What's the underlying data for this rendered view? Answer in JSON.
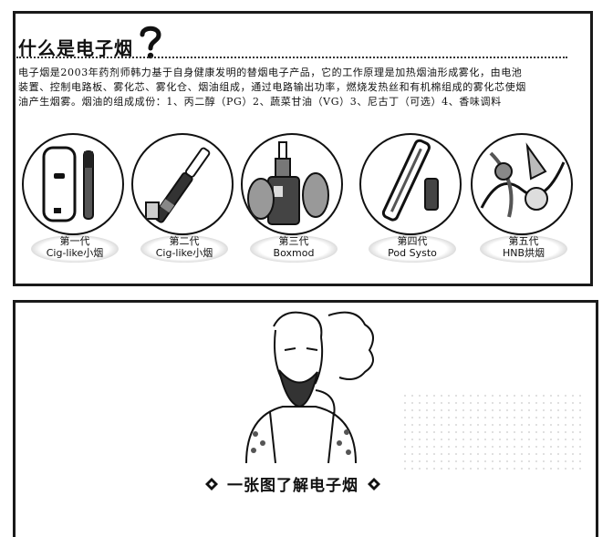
{
  "header": {
    "title": "什么是电子烟",
    "icon": "question-mark-icon"
  },
  "intro": "电子烟是2003年药剂师韩力基于自身健康发明的替烟电子产品，它的工作原理是加热烟油形成雾化，由电池装置、控制电路板、雾化芯、雾化仓、烟油组成，通过电路输出功率，燃烧发热丝和有机棉组成的雾化芯使烟油产生烟雾。烟油的组成成份：1、丙二醇（PG）2、蔬菜甘油（VG）3、尼古丁（可选）4、香味调料",
  "generations": [
    {
      "line1": "第一代",
      "line2": "Cig-like小烟",
      "icon": "cig-like-device-icon"
    },
    {
      "line1": "第二代",
      "line2": "Cig-like小烟",
      "icon": "pen-device-icon"
    },
    {
      "line1": "第三代",
      "line2": "Boxmod",
      "icon": "boxmod-device-icon"
    },
    {
      "line1": "第四代",
      "line2": "Pod Systo",
      "icon": "pod-device-icon"
    },
    {
      "line1": "第五代",
      "line2": "HNB烘烟",
      "icon": "hnb-device-icon"
    }
  ],
  "banner": {
    "text": "一张图了解电子烟",
    "icon": "diamond-icon"
  },
  "illustration": {
    "icon": "vaping-man-illustration"
  }
}
